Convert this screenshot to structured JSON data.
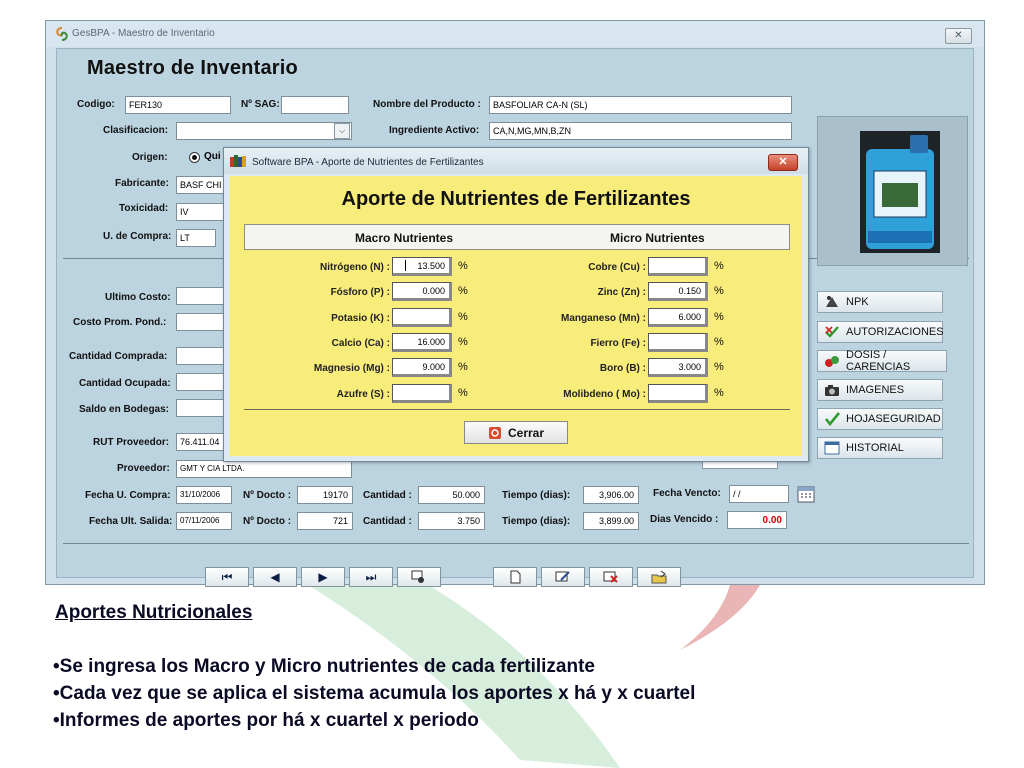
{
  "window": {
    "title": "GesBPA - Maestro de Inventario",
    "close_glyph": "✕",
    "heading": "Maestro de Inventario"
  },
  "form": {
    "codigo_label": "Codigo:",
    "codigo_value": "FER130",
    "nsag_label": "Nº SAG:",
    "nsag_value": "",
    "nombre_label": "Nombre del Producto :",
    "nombre_value": "BASFOLIAR CA-N (SL)",
    "clasificacion_label": "Clasificacion:",
    "clasificacion_value": "",
    "ingrediente_label": "Ingrediente Activo:",
    "ingrediente_value": "CA,N,MG,MN,B,ZN",
    "origen_label": "Origen:",
    "origen_option": "Qui",
    "fabricante_label": "Fabricante:",
    "fabricante_value": "BASF CHI",
    "toxicidad_label": "Toxicidad:",
    "toxicidad_value": "IV",
    "ucompra_label": "U. de Compra:",
    "ucompra_value": "LT",
    "ultimo_costo_label": "Ultimo Costo:",
    "costo_prom_label": "Costo Prom. Pond.:",
    "cant_comprada_label": "Cantidad Comprada:",
    "cant_ocupada_label": "Cantidad Ocupada:",
    "saldo_label": "Saldo en Bodegas:",
    "rut_label": "RUT Proveedor:",
    "rut_value": "76.411.04",
    "proveedor_label": "Proveedor:",
    "proveedor_value": "GMT Y CIA LTDA.",
    "fecha_compra_label": "Fecha U. Compra:",
    "fecha_compra_value": "31/10/2006",
    "ndocto_label_1": "Nº Docto :",
    "ndocto_value_1": "19170",
    "cantidad_label_1": "Cantidad :",
    "cantidad_value_1": "50.000",
    "tiempo_label_1": "Tiempo (dias):",
    "tiempo_value_1": "3,906.00",
    "fecha_vencto_label": "Fecha Vencto:",
    "fecha_vencto_value": " / /",
    "fecha_salida_label": "Fecha Ult. Salida:",
    "fecha_salida_value": "07/11/2006",
    "ndocto_label_2": "Nº Docto :",
    "ndocto_value_2": "721",
    "cantidad_label_2": "Cantidad :",
    "cantidad_value_2": "3.750",
    "tiempo_label_2": "Tiempo (dias):",
    "tiempo_value_2": "3,899.00",
    "dias_vencido_label": "Dias Vencido :",
    "dias_vencido_value": "0.00"
  },
  "side_buttons": [
    {
      "label": "NPK"
    },
    {
      "label": "AUTORIZACIONES"
    },
    {
      "label": "DOSIS / CARENCIAS"
    },
    {
      "label": "IMAGENES"
    },
    {
      "label": "HOJASEGURIDAD"
    },
    {
      "label": "HISTORIAL"
    }
  ],
  "nav": {
    "first": "⏮",
    "prev": "◀",
    "next": "▶",
    "last": "⏭"
  },
  "dialog": {
    "title": "Software BPA - Aporte de Nutrientes de Fertilizantes",
    "close_glyph": "✕",
    "heading": "Aporte de Nutrientes de Fertilizantes",
    "macro_header": "Macro Nutrientes",
    "micro_header": "Micro Nutrientes",
    "percent": "%",
    "macro": [
      {
        "label": "Nitrógeno (N) :",
        "value": "13.500"
      },
      {
        "label": "Fósforo (P) :",
        "value": "0.000"
      },
      {
        "label": "Potasio (K) :",
        "value": ""
      },
      {
        "label": "Calcio (Ca) :",
        "value": "16.000"
      },
      {
        "label": "Magnesio (Mg) :",
        "value": "9.000"
      },
      {
        "label": "Azufre (S) :",
        "value": ""
      }
    ],
    "micro": [
      {
        "label": "Cobre (Cu) :",
        "value": ""
      },
      {
        "label": "Zinc (Zn) :",
        "value": "0.150"
      },
      {
        "label": "Manganeso (Mn) :",
        "value": "6.000"
      },
      {
        "label": "Fierro (Fe) :",
        "value": ""
      },
      {
        "label": "Boro (B) :",
        "value": "3.000"
      },
      {
        "label": "Molibdeno ( Mo) :",
        "value": ""
      }
    ],
    "cerrar_label": "Cerrar"
  },
  "caption": {
    "title": "Aportes Nutricionales",
    "bullets": [
      "•Se ingresa los Macro y Micro nutrientes de cada fertilizante",
      "•Cada vez que se aplica el sistema acumula los aportes x há y x cuartel",
      "•Informes de aportes por há x cuartel x periodo"
    ]
  },
  "colors": {
    "dialog_body": "#f8ec7a",
    "form_bg": "#bcd3e0",
    "caption_text": "#0a0a24",
    "dias_vencido": "#d40000"
  }
}
